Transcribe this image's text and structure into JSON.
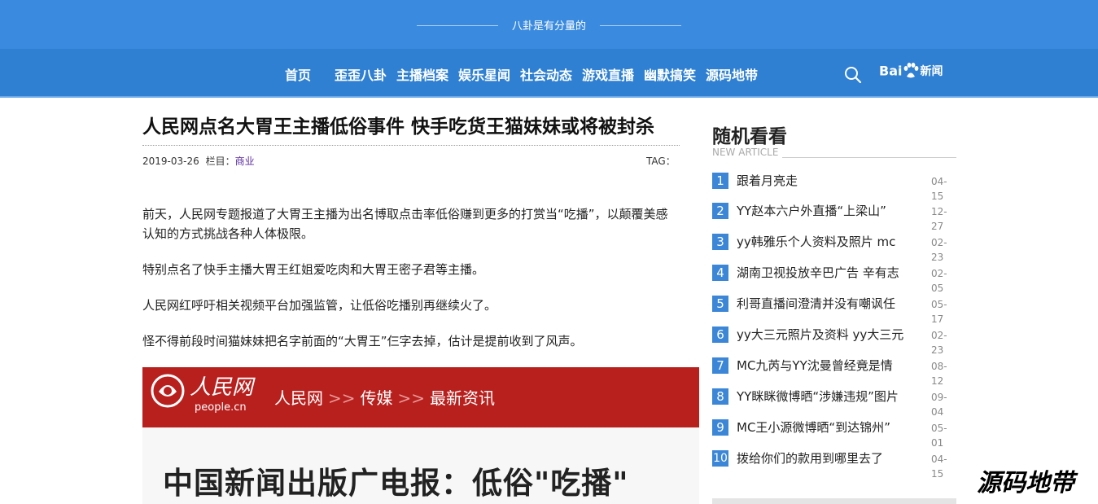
{
  "header": {
    "slogan": "八卦是有分量的",
    "nav": [
      "首页",
      "歪歪八卦",
      "主播档案",
      "娱乐星闻",
      "社会动态",
      "游戏直播",
      "幽默搞笑",
      "源码地带"
    ],
    "baidu_logo_text": "Bai",
    "baidu_news_text": "新闻"
  },
  "article": {
    "title": "人民网点名大胃王主播低俗事件 快手吃货王猫妹妹或将被封杀",
    "date": "2019-03-26",
    "column_label": "栏目：",
    "column_value": "商业",
    "tag_label": "TAG：",
    "paragraphs": [
      "前天，人民网专题报道了大胃王主播为出名博取点击率低俗赚到更多的打赏当“吃播”，以颠覆美感认知的方式挑战各种人体极限。",
      "特别点名了快手主播大胃王红姐爱吃肉和大胃王密子君等主播。",
      "人民网红呼吁相关视频平台加强监管，让低俗吃播别再继续火了。",
      "怪不得前段时间猫妹妹把名字前面的“大胃王”仨字去掉，估计是提前收到了风声。"
    ],
    "banner": {
      "brand": "人民网",
      "url": "people.cn",
      "crumbs": [
        "人民网",
        "传媒",
        "最新资讯"
      ],
      "separator": ">>"
    },
    "headline_image_text": "中国新闻出版广电报：低俗\"吃播\""
  },
  "sidebar": {
    "title": "随机看看",
    "subtitle": "NEW ARTICLE",
    "items": [
      {
        "num": "1",
        "text": "跟着月亮走",
        "date": "04-15"
      },
      {
        "num": "2",
        "text": "YY赵本六户外直播“上梁山”",
        "date": "12-27"
      },
      {
        "num": "3",
        "text": "yy韩雅乐个人资料及照片 mc",
        "date": "02-23"
      },
      {
        "num": "4",
        "text": "湖南卫视投放辛巴广告 辛有志",
        "date": "02-05"
      },
      {
        "num": "5",
        "text": "利哥直播间澄清并没有嘲讽任",
        "date": "05-17"
      },
      {
        "num": "6",
        "text": "yy大三元照片及资料 yy大三元",
        "date": "02-23"
      },
      {
        "num": "7",
        "text": "MC九芮与YY沈曼曾经竟是情",
        "date": "08-12"
      },
      {
        "num": "8",
        "text": "YY眯眯微博晒“涉嫌违规”图片",
        "date": "09-04"
      },
      {
        "num": "9",
        "text": "MC王小源微博晒“到达锦州”",
        "date": "05-01"
      },
      {
        "num": "10",
        "text": "拨给你们的款用到哪里去了",
        "date": "04-15"
      }
    ]
  },
  "watermark": "源码地带",
  "colors": {
    "topbar": "#3a8be0",
    "navbar": "#2f80d2",
    "number_badge": "#3b86d6",
    "banner_red": "#b8201e"
  }
}
